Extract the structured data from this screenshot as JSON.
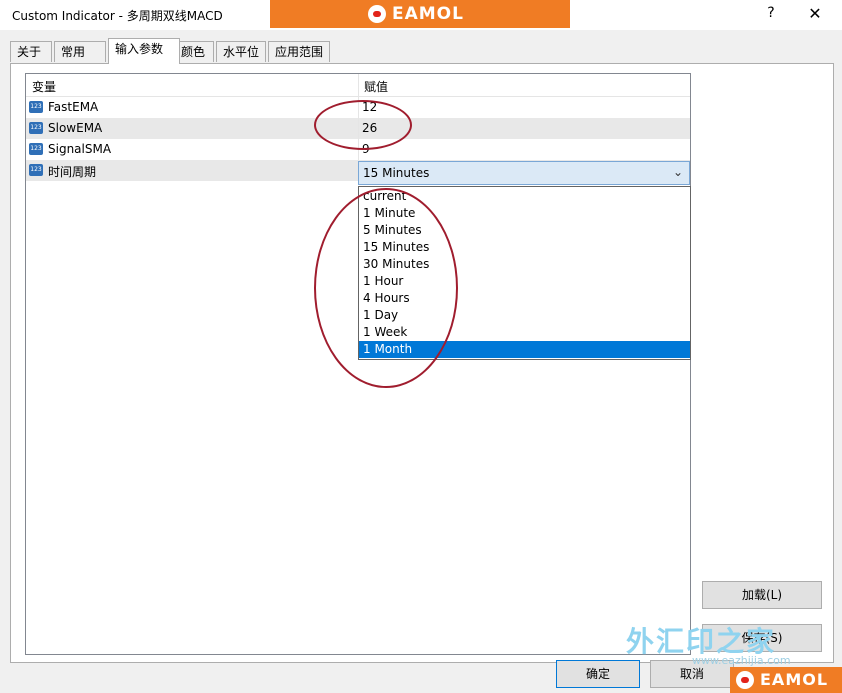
{
  "window": {
    "title": "Custom Indicator - 多周期双线MACD",
    "help_label": "?",
    "close_label": "✕"
  },
  "branding": {
    "top_logo_text": "EAMOL",
    "bottom_logo_text": "EAMOL",
    "watermark_text": "外汇印之家",
    "watermark_url": "www.eazhijia.com",
    "accent_color": "#f07c24"
  },
  "tabs": [
    {
      "label": "关于"
    },
    {
      "label": "常用"
    },
    {
      "label": "输入参数"
    },
    {
      "label": "颜色"
    },
    {
      "label": "水平位"
    },
    {
      "label": "应用范围"
    }
  ],
  "grid": {
    "headers": {
      "variable": "变量",
      "value": "赋值"
    },
    "rows": [
      {
        "icon": "123",
        "name": "FastEMA",
        "value": "12"
      },
      {
        "icon": "123",
        "name": "SlowEMA",
        "value": "26"
      },
      {
        "icon": "123",
        "name": "SignalSMA",
        "value": "9"
      },
      {
        "icon": "123",
        "name": "时间周期",
        "value": "15 Minutes"
      }
    ]
  },
  "dropdown": {
    "options": [
      "current",
      "1 Minute",
      "5 Minutes",
      "15 Minutes",
      "30 Minutes",
      "1 Hour",
      "4 Hours",
      "1 Day",
      "1 Week",
      "1 Month"
    ],
    "highlighted": "1 Month"
  },
  "buttons": {
    "load": "加载(L)",
    "save": "保存(S)",
    "ok": "确定",
    "cancel": "取消"
  },
  "colors": {
    "selection": "#0078d7",
    "annotation": "#a01d2e"
  }
}
